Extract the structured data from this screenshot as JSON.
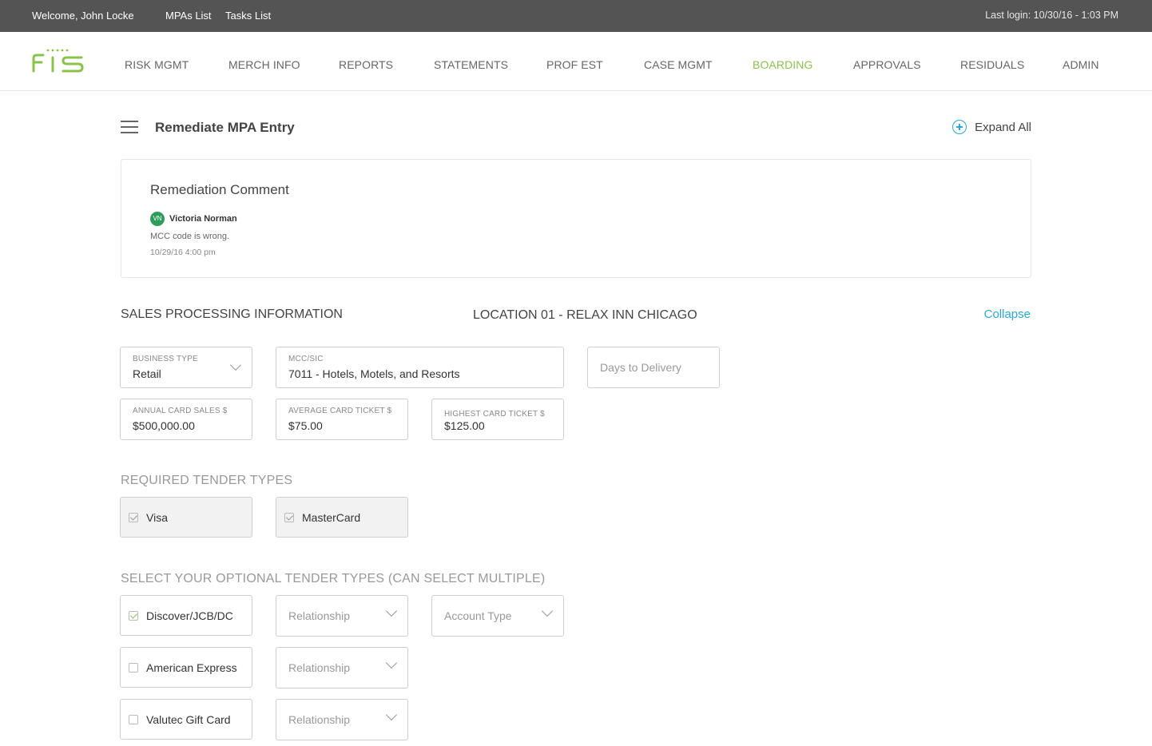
{
  "topbar": {
    "welcome": "Welcome, John Locke",
    "links": [
      "MPAs List",
      "Tasks List"
    ],
    "last_login": "Last login: 10/30/16 - 1:03 PM"
  },
  "nav": {
    "logo_text": "FIS",
    "items": [
      "RISK MGMT",
      "MERCH INFO",
      "REPORTS",
      "STATEMENTS",
      "PROF EST",
      "CASE MGMT",
      "BOARDING",
      "APPROVALS",
      "RESIDUALS",
      "ADMIN"
    ],
    "active": "BOARDING"
  },
  "page": {
    "title": "Remediate MPA Entry",
    "expand_all": "Expand All"
  },
  "comment": {
    "title": "Remediation Comment",
    "avatar": "VN",
    "author": "Victoria Norman",
    "text": "MCC code is wrong.",
    "date": "10/29/16 4:00 pm"
  },
  "sales": {
    "title": "SALES PROCESSING INFORMATION",
    "location": "LOCATION 01 - RELAX INN CHICAGO",
    "collapse": "Collapse",
    "business_type": {
      "label": "BUSINESS TYPE",
      "value": "Retail"
    },
    "mcc": {
      "label": "MCC/SIC",
      "value": "7011 - Hotels, Motels, and Resorts"
    },
    "days_to_delivery": {
      "placeholder": "Days to Delivery"
    },
    "annual_sales": {
      "label": "ANNUAL CARD SALES $",
      "value": "$500,000.00"
    },
    "avg_ticket": {
      "label": "AVERAGE CARD TICKET $",
      "value": "$75.00"
    },
    "high_ticket": {
      "label": "HIGHEST CARD TICKET $",
      "value": "$125.00"
    }
  },
  "required_tenders": {
    "title": "REQUIRED TENDER TYPES",
    "items": [
      {
        "label": "Visa",
        "checked": true
      },
      {
        "label": "MasterCard",
        "checked": true
      }
    ]
  },
  "optional_tenders": {
    "title": "SELECT YOUR  OPTIONAL TENDER TYPES (CAN SELECT MULTIPLE)",
    "relationship_placeholder": "Relationship",
    "account_type_placeholder": "Account Type",
    "items": [
      {
        "label": "Discover/JCB/DC",
        "checked": true
      },
      {
        "label": "American Express",
        "checked": false
      },
      {
        "label": "Valutec Gift Card",
        "checked": false
      }
    ]
  },
  "colors": {
    "topbar": "#545454",
    "accent_green": "#8bc34a",
    "link_blue": "#29a8e0",
    "avatar_green": "#2e9d5c"
  }
}
